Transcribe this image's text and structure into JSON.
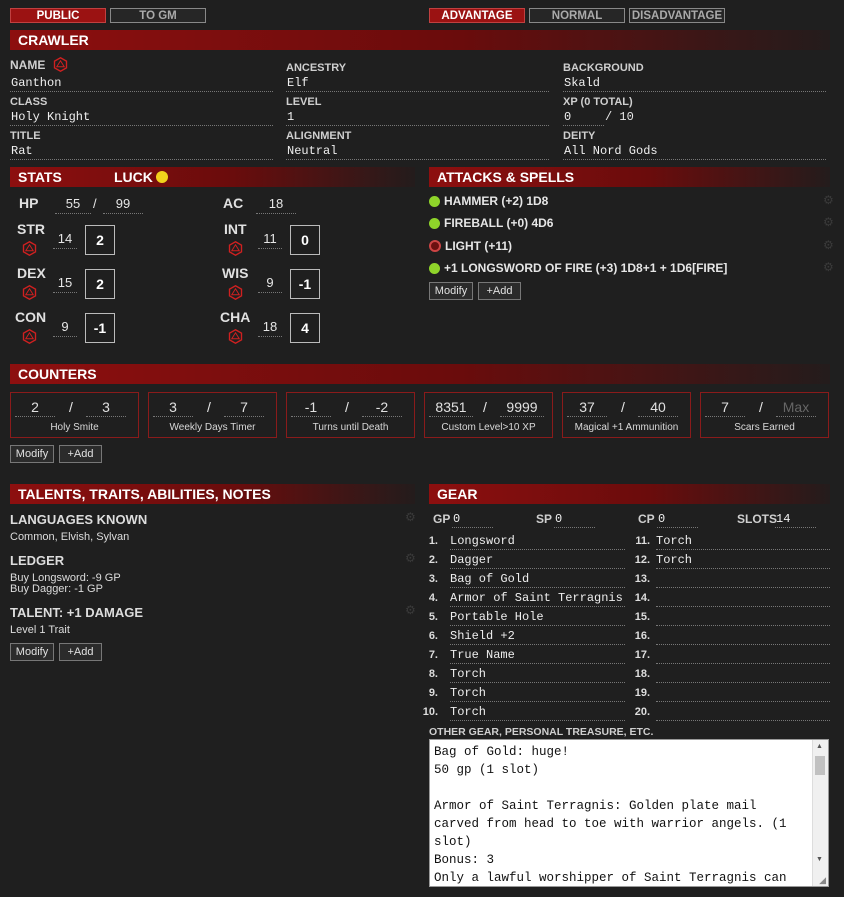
{
  "top": {
    "public": "PUBLIC",
    "to_gm": "TO GM",
    "advantage": "ADVANTAGE",
    "normal": "NORMAL",
    "disadvantage": "DISADVANTAGE"
  },
  "crawler": {
    "header": "CRAWLER",
    "name_label": "NAME",
    "name": "Ganthon",
    "ancestry_label": "ANCESTRY",
    "ancestry": "Elf",
    "background_label": "BACKGROUND",
    "background": "Skald",
    "class_label": "CLASS",
    "class": "Holy Knight",
    "level_label": "LEVEL",
    "level": "1",
    "xp_label": "XP (0 TOTAL)",
    "xp": "0",
    "xp_max": "/ 10",
    "title_label": "TITLE",
    "title": "Rat",
    "alignment_label": "ALIGNMENT",
    "alignment": "Neutral",
    "deity_label": "DEITY",
    "deity": "All Nord Gods"
  },
  "stats": {
    "header": "STATS",
    "luck": "LUCK",
    "hp_label": "HP",
    "hp": "55",
    "hp_sep": "/",
    "hp_max": "99",
    "ac_label": "AC",
    "ac": "18",
    "str": {
      "name": "STR",
      "score": "14",
      "mod": "2"
    },
    "dex": {
      "name": "DEX",
      "score": "15",
      "mod": "2"
    },
    "con": {
      "name": "CON",
      "score": "9",
      "mod": "-1"
    },
    "int": {
      "name": "INT",
      "score": "11",
      "mod": "0"
    },
    "wis": {
      "name": "WIS",
      "score": "9",
      "mod": "-1"
    },
    "cha": {
      "name": "CHA",
      "score": "18",
      "mod": "4"
    }
  },
  "attacks": {
    "header": "ATTACKS & SPELLS",
    "items": [
      {
        "label": "HAMMER (+2) 1D8",
        "active": true
      },
      {
        "label": "FIREBALL (+0) 4D6",
        "active": true
      },
      {
        "label": "LIGHT (+11)",
        "active": false
      },
      {
        "label": "+1 LONGSWORD OF FIRE (+3) 1D8+1 + 1D6[FIRE]",
        "active": true
      }
    ],
    "modify": "Modify",
    "add": "+Add"
  },
  "counters": {
    "header": "COUNTERS",
    "items": [
      {
        "cur": "2",
        "max": "3",
        "label": "Holy Smite"
      },
      {
        "cur": "3",
        "max": "7",
        "label": "Weekly Days Timer"
      },
      {
        "cur": "-1",
        "max": "-2",
        "label": "Turns until Death"
      },
      {
        "cur": "8351",
        "max": "9999",
        "label": "Custom Level>10 XP"
      },
      {
        "cur": "37",
        "max": "40",
        "label": "Magical +1 Ammunition"
      },
      {
        "cur": "7",
        "max": "Max",
        "label": "Scars Earned"
      }
    ],
    "sep": "/",
    "modify": "Modify",
    "add": "+Add"
  },
  "talents": {
    "header": "TALENTS, TRAITS, ABILITIES, NOTES",
    "items": [
      {
        "title": "LANGUAGES KNOWN",
        "lines": [
          "Common, Elvish, Sylvan"
        ]
      },
      {
        "title": "LEDGER",
        "lines": [
          "Buy Longsword: -9 GP",
          "Buy Dagger: -1 GP"
        ]
      },
      {
        "title": "TALENT: +1 DAMAGE",
        "lines": [
          "Level 1 Trait"
        ]
      }
    ],
    "modify": "Modify",
    "add": "+Add"
  },
  "gear": {
    "header": "GEAR",
    "gp_label": "GP",
    "gp": "0",
    "sp_label": "SP",
    "sp": "0",
    "cp_label": "CP",
    "cp": "0",
    "slots_label": "SLOTS",
    "slots": "14",
    "left": [
      "Longsword",
      "Dagger",
      "Bag of Gold",
      "Armor of Saint Terragnis",
      "Portable Hole",
      "Shield +2",
      "True Name",
      "Torch",
      "Torch",
      "Torch"
    ],
    "right": [
      "Torch",
      "Torch",
      "",
      "",
      "",
      "",
      "",
      "",
      "",
      ""
    ],
    "other_label": "OTHER GEAR, PERSONAL TREASURE, ETC.",
    "notes": "Bag of Gold: huge!\n50 gp (1 slot)\n\nArmor of Saint Terragnis: Golden plate mail carved from head to toe with warrior angels. (1 slot)\nBonus: 3\nOnly a lawful worshipper of Saint Terragnis can wear this armor."
  }
}
